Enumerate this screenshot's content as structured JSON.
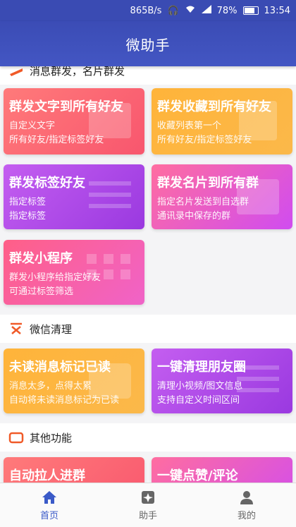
{
  "statusbar": {
    "speed": "865B/s",
    "battery": "78%",
    "time": "13:54"
  },
  "title": "微助手",
  "sections": {
    "broadcast": {
      "title": "消息群发，名片群发"
    },
    "wechat_clean": {
      "title": "微信清理"
    },
    "other": {
      "title": "其他功能"
    }
  },
  "cards": {
    "c1": {
      "title": "群发文字到所有好友",
      "lines": [
        "自定义文字",
        "所有好友/指定标签好友"
      ]
    },
    "c2": {
      "title": "群发收藏到所有好友",
      "lines": [
        "收藏列表第一个",
        "所有好友/指定标签好友"
      ]
    },
    "c3": {
      "title": "群发标签好友",
      "lines": [
        "指定标签",
        "指定标签"
      ]
    },
    "c4": {
      "title": "群发名片到所有群",
      "lines": [
        "指定名片发送到自选群",
        "通讯录中保存的群"
      ]
    },
    "c5": {
      "title": "群发小程序",
      "lines": [
        "群发小程序给指定好友",
        "可通过标签筛选"
      ]
    },
    "c6": {
      "title": "未读消息标记已读",
      "lines": [
        "消息太多，点得太累",
        "自动将未读消息标记为已读"
      ]
    },
    "c7": {
      "title": "一键清理朋友圈",
      "lines": [
        "清理小视频/图文信息",
        "支持自定义时间区间"
      ]
    },
    "c8": {
      "title": "自动拉人进群",
      "lines": []
    },
    "c9": {
      "title": "一键点赞/评论",
      "lines": []
    }
  },
  "tabs": [
    {
      "label": "首页",
      "icon": "home-icon",
      "active": true
    },
    {
      "label": "助手",
      "icon": "assistant-icon",
      "active": false
    },
    {
      "label": "我的",
      "icon": "user-icon",
      "active": false
    }
  ],
  "colors": {
    "primary": "#3a4bb3",
    "active_tab": "#3a5ac8"
  }
}
